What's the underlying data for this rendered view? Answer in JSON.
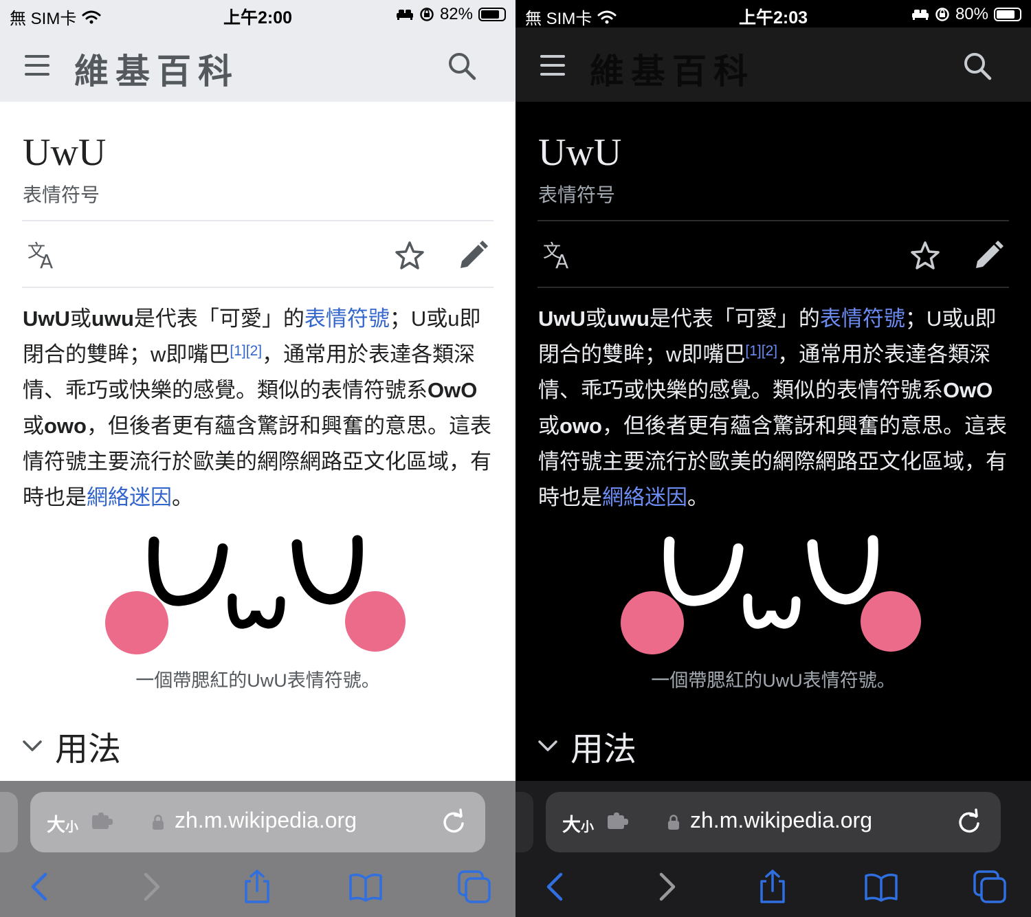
{
  "colors": {
    "link_light": "#3366cc",
    "link_dark": "#6b8cf2",
    "safari_blue": "#2f6fe0",
    "blush": "#ec6a8a"
  },
  "panels": [
    {
      "theme": "light",
      "status": {
        "carrier": "無 SIM卡",
        "time": "上午2:00",
        "battery": "82%",
        "battery_level": 0.82
      },
      "logo": "維基百科",
      "title": "UwU",
      "subtitle": "表情符号",
      "body": {
        "s1_bold": "UwU",
        "s2": "或",
        "s3_bold": "uwu",
        "s4": "是代表「可愛」的",
        "s5_link": "表情符號",
        "s6": "；U或u即閉合的雙眸；w即嘴巴",
        "ref1": "[1]",
        "ref2": "[2]",
        "s7": "，通常用於表達各類深情、乖巧或快樂的感覺。類似的表情符號系",
        "s8_bold": "OwO",
        "s9": "或",
        "s10_bold": "owo",
        "s11": "，但後者更有蘊含驚訝和興奮的意思。這表情符號主要流行於歐美的網際網路亞文化區域，有時也是",
        "s12_link": "網絡迷因",
        "s13": "。"
      },
      "caption": "一個帶腮紅的UwU表情符號。",
      "section_heading": "用法",
      "toolbar": {
        "size_label": "大",
        "size_small": "小",
        "url": "zh.m.wikipedia.org"
      }
    },
    {
      "theme": "dark",
      "status": {
        "carrier": "無 SIM卡",
        "time": "上午2:03",
        "battery": "80%",
        "battery_level": 0.8
      },
      "logo": "維基百科",
      "title": "UwU",
      "subtitle": "表情符号",
      "body": {
        "s1_bold": "UwU",
        "s2": "或",
        "s3_bold": "uwu",
        "s4": "是代表「可愛」的",
        "s5_link": "表情符號",
        "s6": "；U或u即閉合的雙眸；w即嘴巴",
        "ref1": "[1]",
        "ref2": "[2]",
        "s7": "，通常用於表達各類深情、乖巧或快樂的感覺。類似的表情符號系",
        "s8_bold": "OwO",
        "s9": "或",
        "s10_bold": "owo",
        "s11": "，但後者更有蘊含驚訝和興奮的意思。這表情符號主要流行於歐美的網際網路亞文化區域，有時也是",
        "s12_link": "網絡迷因",
        "s13": "。"
      },
      "caption": "一個帶腮紅的UwU表情符號。",
      "section_heading": "用法",
      "toolbar": {
        "size_label": "大",
        "size_small": "小",
        "url": "zh.m.wikipedia.org"
      }
    }
  ]
}
